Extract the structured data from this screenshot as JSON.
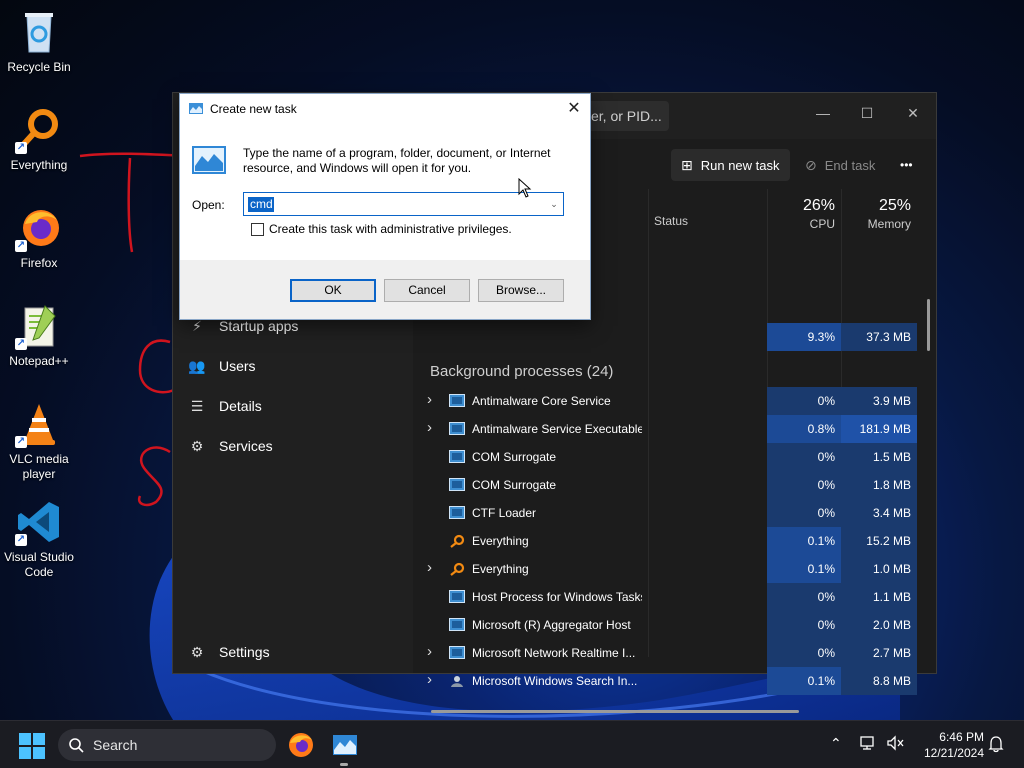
{
  "desktop": {
    "icons": [
      {
        "label": "Recycle Bin",
        "icon": "recycle-bin-icon"
      },
      {
        "label": "Everything",
        "icon": "everything-icon"
      },
      {
        "label": "Firefox",
        "icon": "firefox-icon"
      },
      {
        "label": "Notepad++",
        "icon": "notepad-plus-plus-icon"
      },
      {
        "label": "VLC media player",
        "icon": "vlc-icon"
      },
      {
        "label": "Visual Studio Code",
        "icon": "vscode-icon"
      }
    ]
  },
  "task_manager": {
    "search_text": "er, or PID...",
    "toolbar": {
      "run_new_task": "Run new task",
      "end_task": "End task",
      "more": "•••"
    },
    "columns": {
      "status": "Status",
      "cpu_pct": "26%",
      "cpu": "CPU",
      "mem_pct": "25%",
      "memory": "Memory"
    },
    "nav": [
      {
        "label": "Startup apps",
        "icon": "startup-apps-icon"
      },
      {
        "label": "Users",
        "icon": "users-icon"
      },
      {
        "label": "Details",
        "icon": "details-icon"
      },
      {
        "label": "Services",
        "icon": "services-icon"
      },
      {
        "label": "Settings",
        "icon": "settings-icon"
      }
    ],
    "top_row": {
      "cpu": "9.3%",
      "memory": "37.3 MB"
    },
    "background_title": "Background processes (24)",
    "processes": [
      {
        "name": "Antimalware Core Service",
        "cpu": "0%",
        "memory": "3.9 MB",
        "expandable": true,
        "icon": "app"
      },
      {
        "name": "Antimalware Service Executable",
        "cpu": "0.8%",
        "memory": "181.9 MB",
        "expandable": true,
        "icon": "app"
      },
      {
        "name": "COM Surrogate",
        "cpu": "0%",
        "memory": "1.5 MB",
        "expandable": false,
        "icon": "app"
      },
      {
        "name": "COM Surrogate",
        "cpu": "0%",
        "memory": "1.8 MB",
        "expandable": false,
        "icon": "app"
      },
      {
        "name": "CTF Loader",
        "cpu": "0%",
        "memory": "3.4 MB",
        "expandable": false,
        "icon": "app"
      },
      {
        "name": "Everything",
        "cpu": "0.1%",
        "memory": "15.2 MB",
        "expandable": false,
        "icon": "everything"
      },
      {
        "name": "Everything",
        "cpu": "0.1%",
        "memory": "1.0 MB",
        "expandable": true,
        "icon": "everything"
      },
      {
        "name": "Host Process for Windows Tasks",
        "cpu": "0%",
        "memory": "1.1 MB",
        "expandable": false,
        "icon": "app"
      },
      {
        "name": "Microsoft (R) Aggregator Host",
        "cpu": "0%",
        "memory": "2.0 MB",
        "expandable": false,
        "icon": "app"
      },
      {
        "name": "Microsoft Network Realtime I...",
        "cpu": "0%",
        "memory": "2.7 MB",
        "expandable": true,
        "icon": "app"
      },
      {
        "name": "Microsoft Windows Search In...",
        "cpu": "0.1%",
        "memory": "8.8 MB",
        "expandable": true,
        "icon": "search-indexer"
      }
    ]
  },
  "run_dialog": {
    "title": "Create new task",
    "description": "Type the name of a program, folder, document, or Internet resource, and Windows will open it for you.",
    "open_label": "Open:",
    "open_value": "cmd",
    "admin_checkbox": "Create this task with administrative privileges.",
    "ok": "OK",
    "cancel": "Cancel",
    "browse": "Browse..."
  },
  "taskbar": {
    "search_placeholder": "Search",
    "time": "6:46 PM",
    "date": "12/21/2024"
  },
  "colors": {
    "accent": "#0a64c8",
    "cpu_cell": "#1a3a6e",
    "cpu_cell_high": "#1c4a96",
    "mem_cell": "#1a3a6e",
    "mem_cell_high": "#1f52a8",
    "annotation": "#d0141e"
  }
}
